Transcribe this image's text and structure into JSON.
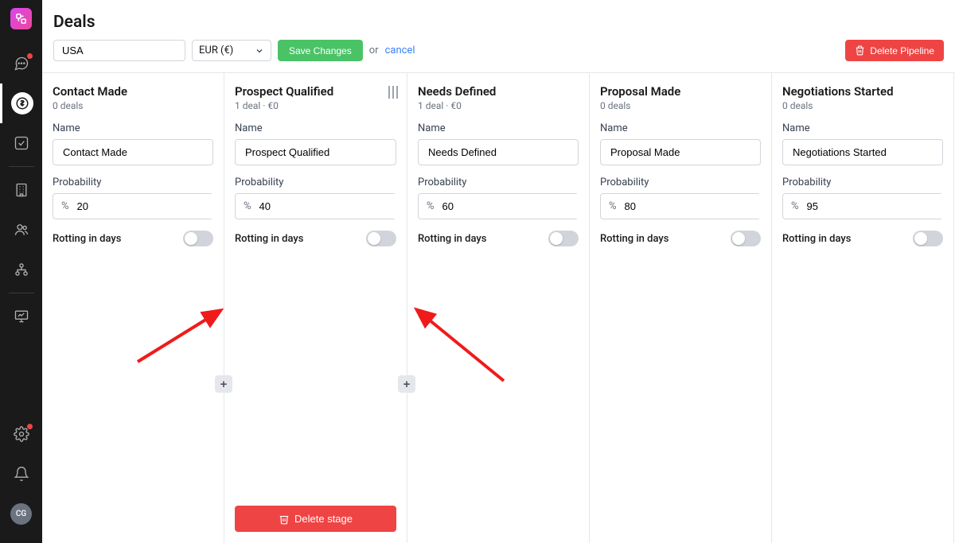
{
  "page": {
    "title": "Deals"
  },
  "toolbar": {
    "pipeline_name": "USA",
    "currency": "EUR (€)",
    "save_label": "Save Changes",
    "or_label": "or",
    "cancel_label": "cancel",
    "delete_pipeline_label": "Delete Pipeline"
  },
  "labels": {
    "name": "Name",
    "probability": "Probability",
    "rotting": "Rotting in days",
    "percent": "%",
    "delete_stage": "Delete stage"
  },
  "stages": [
    {
      "title": "Contact Made",
      "name_value": "Contact Made",
      "meta": "0 deals",
      "probability": "20",
      "rotting_on": false,
      "selected": false,
      "show_add": true,
      "show_delete": false,
      "show_drag": false
    },
    {
      "title": "Prospect Qualified",
      "name_value": "Prospect Qualified",
      "meta": "1 deal · €0",
      "probability": "40",
      "rotting_on": false,
      "selected": true,
      "show_add": true,
      "show_delete": true,
      "show_drag": true
    },
    {
      "title": "Needs Defined",
      "name_value": "Needs Defined",
      "meta": "1 deal · €0",
      "probability": "60",
      "rotting_on": false,
      "selected": false,
      "show_add": false,
      "show_delete": false,
      "show_drag": false
    },
    {
      "title": "Proposal Made",
      "name_value": "Proposal Made",
      "meta": "0 deals",
      "probability": "80",
      "rotting_on": false,
      "selected": false,
      "show_add": false,
      "show_delete": false,
      "show_drag": false
    },
    {
      "title": "Negotiations Started",
      "name_value": "Negotiations Started",
      "meta": "0 deals",
      "probability": "95",
      "rotting_on": false,
      "selected": false,
      "show_add": false,
      "show_delete": false,
      "show_drag": false
    }
  ],
  "sidebar": {
    "avatar": "CG"
  }
}
